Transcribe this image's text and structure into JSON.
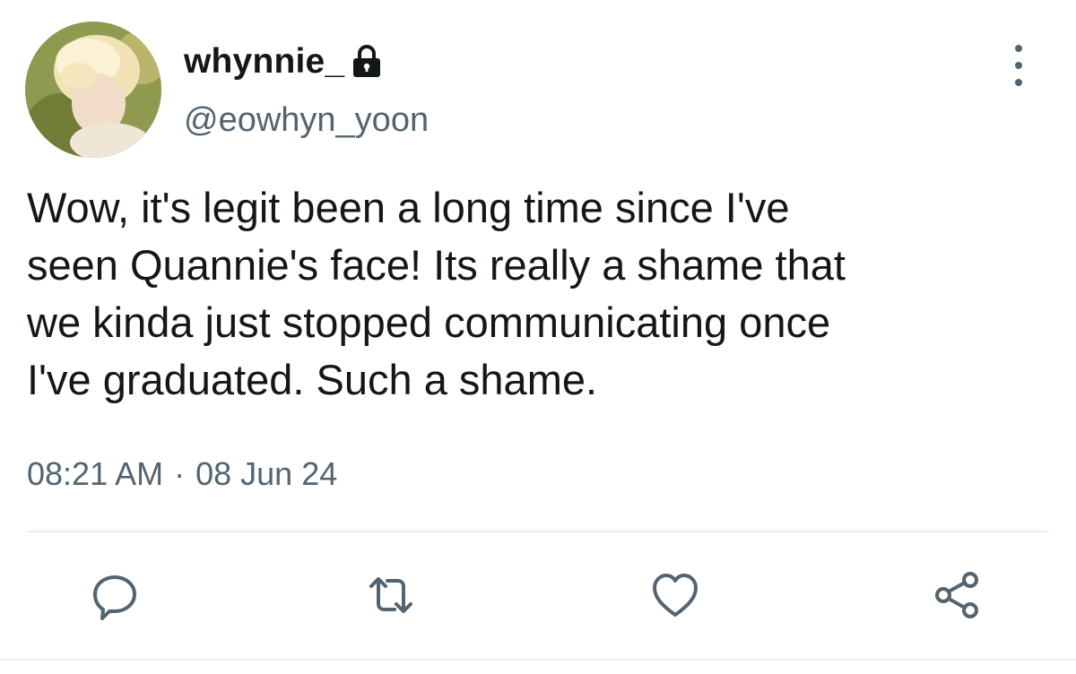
{
  "user": {
    "display_name": "whynnie_",
    "handle": "@eowhyn_yoon",
    "avatar": "profile-photo"
  },
  "tweet": {
    "text": "Wow, it's legit been a long time since I've\nseen Quannie's face! Its really a shame that\nwe kinda just stopped communicating once\nI've graduated. Such a shame.",
    "time": "08:21 AM",
    "separator": "·",
    "date": "08 Jun 24"
  },
  "icons": {
    "protected": "lock-icon",
    "more": "more-vertical-icon",
    "reply": "reply-icon",
    "retweet": "retweet-icon",
    "like": "heart-icon",
    "share": "share-icon"
  },
  "colors": {
    "text_primary": "#14171a",
    "text_secondary": "#536471",
    "divider": "#e6ecf0"
  }
}
